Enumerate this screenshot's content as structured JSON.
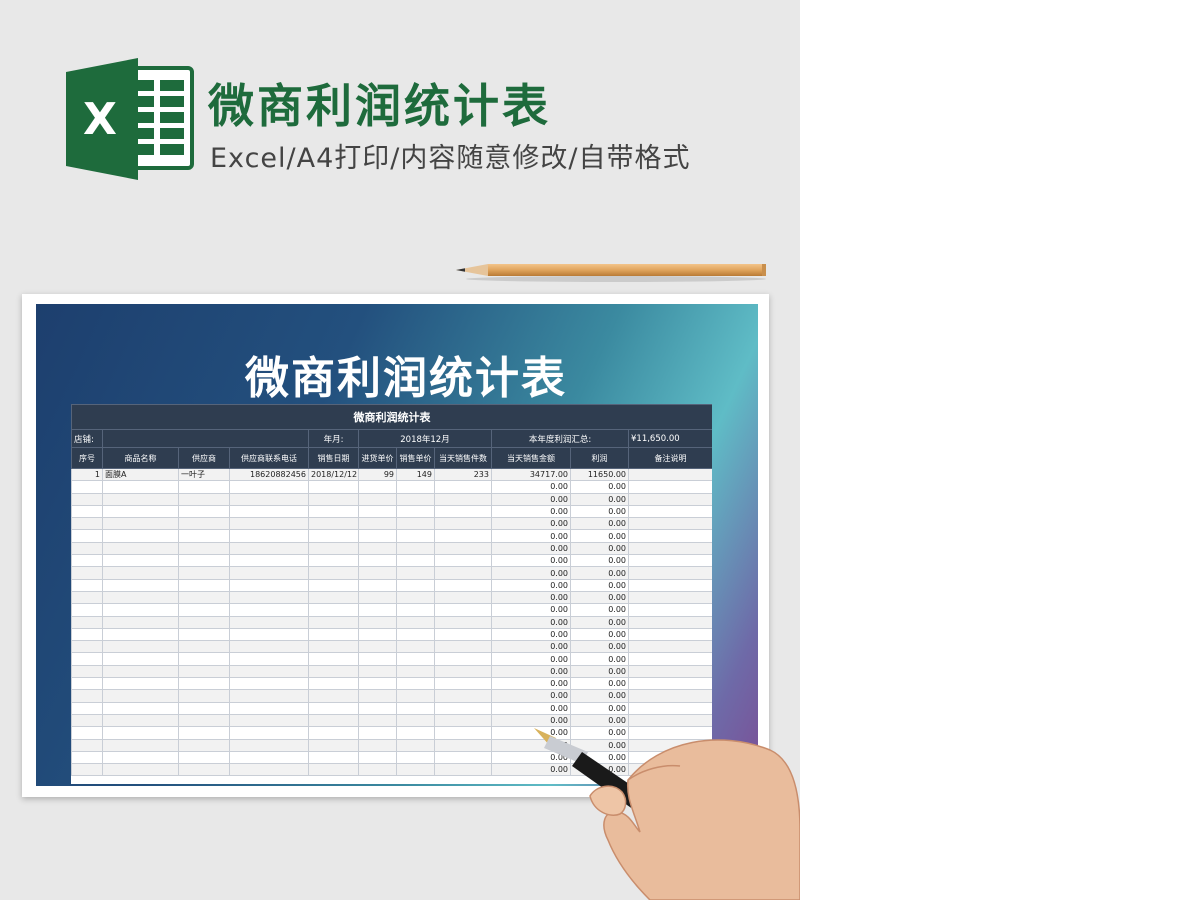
{
  "header": {
    "title": "微商利润统计表",
    "subtitle": "Excel/A4打印/内容随意修改/自带格式",
    "logo_letter": "X"
  },
  "colors": {
    "excel_green": "#1e6b3c",
    "table_header": "#2f3d50",
    "pencil": "#e0a45c"
  },
  "banner": {
    "title": "微商利润统计表"
  },
  "sheet": {
    "title": "微商利润统计表",
    "info": {
      "store_label": "店铺:",
      "store_value": "",
      "month_label": "年月:",
      "month_value": "2018年12月",
      "profit_total_label": "本年度利润汇总:",
      "profit_total_value": "¥11,650.00"
    },
    "columns": [
      "序号",
      "商品名称",
      "供应商",
      "供应商联系电话",
      "销售日期",
      "进货单价",
      "销售单价",
      "当天销售件数",
      "当天销售金额",
      "利润",
      "备注说明"
    ],
    "rows": [
      [
        "1",
        "面膜A",
        "一叶子",
        "18620882456",
        "2018/12/12",
        "99",
        "149",
        "233",
        "34717.00",
        "11650.00",
        ""
      ],
      [
        "",
        "",
        "",
        "",
        "",
        "",
        "",
        "",
        "0.00",
        "0.00",
        ""
      ],
      [
        "",
        "",
        "",
        "",
        "",
        "",
        "",
        "",
        "0.00",
        "0.00",
        ""
      ],
      [
        "",
        "",
        "",
        "",
        "",
        "",
        "",
        "",
        "0.00",
        "0.00",
        ""
      ],
      [
        "",
        "",
        "",
        "",
        "",
        "",
        "",
        "",
        "0.00",
        "0.00",
        ""
      ],
      [
        "",
        "",
        "",
        "",
        "",
        "",
        "",
        "",
        "0.00",
        "0.00",
        ""
      ],
      [
        "",
        "",
        "",
        "",
        "",
        "",
        "",
        "",
        "0.00",
        "0.00",
        ""
      ],
      [
        "",
        "",
        "",
        "",
        "",
        "",
        "",
        "",
        "0.00",
        "0.00",
        ""
      ],
      [
        "",
        "",
        "",
        "",
        "",
        "",
        "",
        "",
        "0.00",
        "0.00",
        ""
      ],
      [
        "",
        "",
        "",
        "",
        "",
        "",
        "",
        "",
        "0.00",
        "0.00",
        ""
      ],
      [
        "",
        "",
        "",
        "",
        "",
        "",
        "",
        "",
        "0.00",
        "0.00",
        ""
      ],
      [
        "",
        "",
        "",
        "",
        "",
        "",
        "",
        "",
        "0.00",
        "0.00",
        ""
      ],
      [
        "",
        "",
        "",
        "",
        "",
        "",
        "",
        "",
        "0.00",
        "0.00",
        ""
      ],
      [
        "",
        "",
        "",
        "",
        "",
        "",
        "",
        "",
        "0.00",
        "0.00",
        ""
      ],
      [
        "",
        "",
        "",
        "",
        "",
        "",
        "",
        "",
        "0.00",
        "0.00",
        ""
      ],
      [
        "",
        "",
        "",
        "",
        "",
        "",
        "",
        "",
        "0.00",
        "0.00",
        ""
      ],
      [
        "",
        "",
        "",
        "",
        "",
        "",
        "",
        "",
        "0.00",
        "0.00",
        ""
      ],
      [
        "",
        "",
        "",
        "",
        "",
        "",
        "",
        "",
        "0.00",
        "0.00",
        ""
      ],
      [
        "",
        "",
        "",
        "",
        "",
        "",
        "",
        "",
        "0.00",
        "0.00",
        ""
      ],
      [
        "",
        "",
        "",
        "",
        "",
        "",
        "",
        "",
        "0.00",
        "0.00",
        ""
      ],
      [
        "",
        "",
        "",
        "",
        "",
        "",
        "",
        "",
        "0.00",
        "0.00",
        ""
      ],
      [
        "",
        "",
        "",
        "",
        "",
        "",
        "",
        "",
        "0.00",
        "0.00",
        ""
      ],
      [
        "",
        "",
        "",
        "",
        "",
        "",
        "",
        "",
        "0.00",
        "0.00",
        ""
      ],
      [
        "",
        "",
        "",
        "",
        "",
        "",
        "",
        "",
        "0.00",
        "0.00",
        ""
      ],
      [
        "",
        "",
        "",
        "",
        "",
        "",
        "",
        "",
        "0.00",
        "0.00",
        ""
      ]
    ]
  },
  "decor": [
    "excel-logo-icon",
    "pencil-icon",
    "hand-with-pen-icon"
  ]
}
